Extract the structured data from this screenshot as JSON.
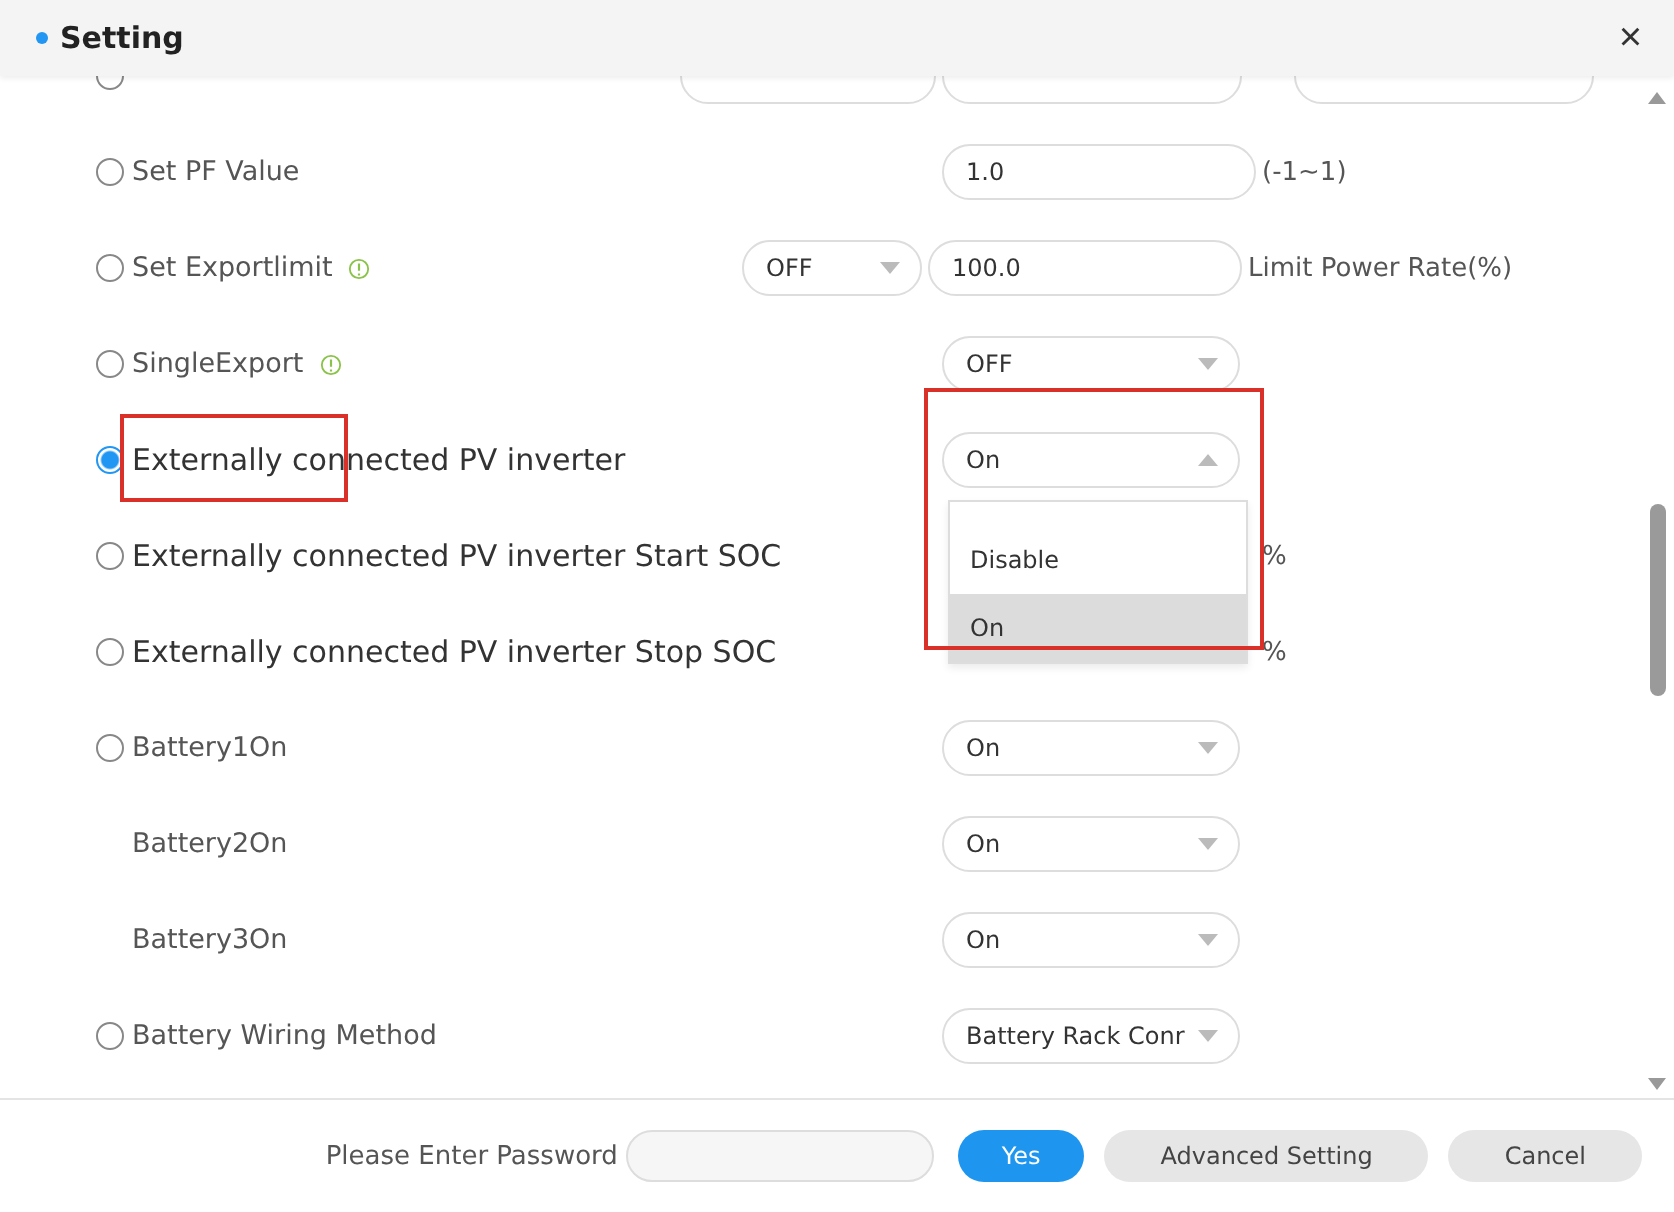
{
  "window": {
    "title": "Setting",
    "close": "×"
  },
  "partial_row": {
    "selected": false
  },
  "rows": [
    {
      "kind": "input",
      "label": "Set PF Value",
      "selected": false,
      "value": "1.0",
      "unit": "(-1~1)"
    },
    {
      "kind": "select_input",
      "label": "Set Exportlimit",
      "selected": false,
      "info": true,
      "select": "OFF",
      "value": "100.0",
      "unit": "Limit Power Rate(%)"
    },
    {
      "kind": "select",
      "label": "SingleExport",
      "selected": false,
      "info": true,
      "select": "OFF"
    },
    {
      "kind": "select",
      "label": "Externally connected PV inverter",
      "selected": true,
      "large": true,
      "highlighted": true,
      "select": "On",
      "expanded": true,
      "options": [
        {
          "label": "Disable",
          "selected": false
        },
        {
          "label": "On",
          "selected": true
        }
      ]
    },
    {
      "kind": "hidden",
      "label": "Externally connected PV inverter Start SOC",
      "selected": false,
      "large": true,
      "unit": "%"
    },
    {
      "kind": "hidden",
      "label": "Externally connected PV inverter Stop SOC",
      "selected": false,
      "large": true,
      "unit": "%"
    },
    {
      "kind": "select",
      "label": "Battery1On",
      "selected": false,
      "select": "On"
    },
    {
      "kind": "select",
      "label": "Battery2On",
      "select": "On"
    },
    {
      "kind": "select",
      "label": "Battery3On",
      "select": "On"
    },
    {
      "kind": "select",
      "label": "Battery Wiring Method",
      "selected": false,
      "select": "Battery Rack Conr"
    }
  ],
  "footer": {
    "password_label": "Please Enter Password",
    "buttons": [
      {
        "label": "Yes",
        "kind": "primary"
      },
      {
        "label": "Advanced Setting",
        "kind": "secondary"
      },
      {
        "label": "Cancel",
        "kind": "secondary"
      }
    ]
  }
}
